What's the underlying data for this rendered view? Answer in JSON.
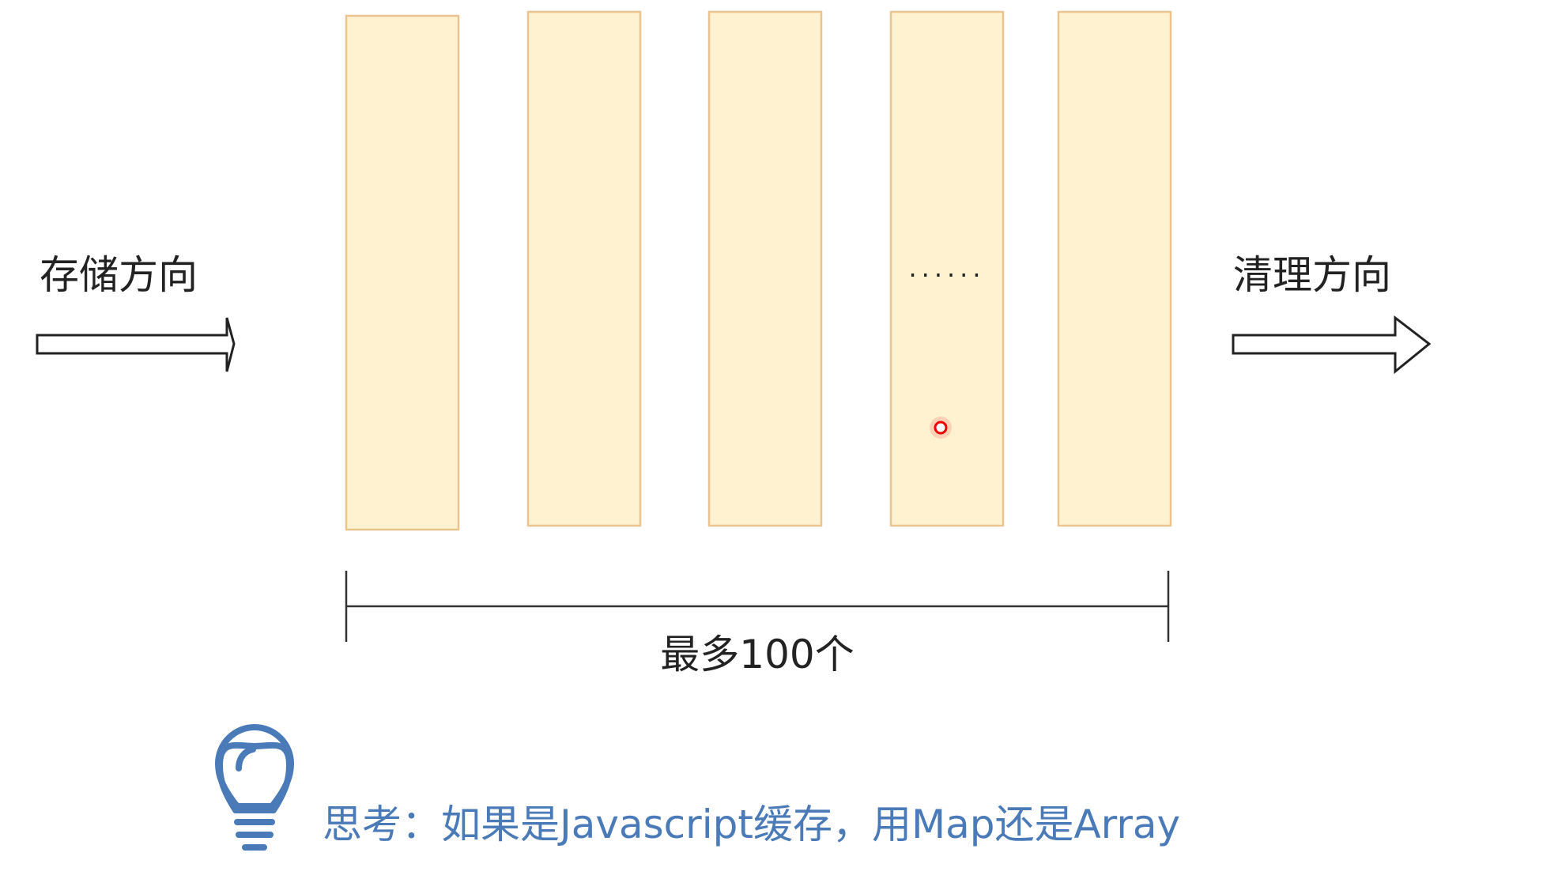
{
  "labels": {
    "store_direction": "存储方向",
    "clear_direction": "清理方向",
    "ellipsis": "......",
    "max_count": "最多100个",
    "think": "思考：如果是Javascript缓存，用Map还是Array"
  },
  "colors": {
    "box_fill": "#fff2d1",
    "box_stroke": "#e9c48f",
    "line": "#333333",
    "text": "#222222",
    "think_blue": "#4a7ab8",
    "laser_red": "#ee0000"
  },
  "icons": {
    "bulb": "lightbulb-icon",
    "arrow": "right-arrow-icon",
    "pointer": "laser-pointer-dot"
  }
}
